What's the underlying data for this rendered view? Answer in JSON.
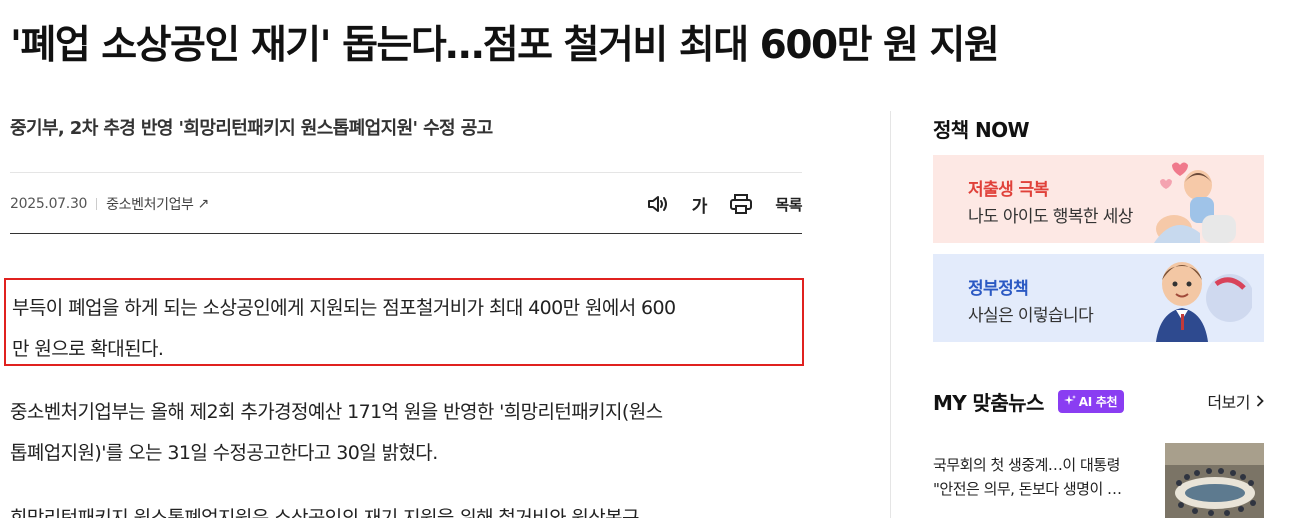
{
  "article": {
    "headline": "'폐업 소상공인 재기' 돕는다…점포 철거비 최대 600만 원 지원",
    "subtitle": "중기부, 2차 추경 반영 '희망리턴패키지 원스톱폐업지원' 수정 공고",
    "date": "2025.07.30",
    "source": "중소벤처기업부",
    "source_arrow": "↗",
    "tools": {
      "listen_icon": "speaker-icon",
      "font_label": "가",
      "print_icon": "printer-icon",
      "list_label": "목록"
    },
    "lead_lines": [
      "부득이 폐업을 하게 되는 소상공인에게 지원되는 점포철거비가 최대 400만 원에서 600",
      "만 원으로 확대된다."
    ],
    "body_p1_lines": [
      "중소벤처기업부는 올해 제2회 추가경정예산 171억 원을 반영한 '희망리턴패키지(원스",
      "톱폐업지원)'를 오는 31일 수정공고한다고 30일 밝혔다."
    ],
    "body_p2_partial": "희망리턴패키지 원스톱폐업지원은 소상공인의 재기 지원을 위해 철거비와 원상복구"
  },
  "sidebar": {
    "now_title": "정책 NOW",
    "banners": [
      {
        "title": "저출생 극복",
        "subtitle": "나도 아이도 행복한 세상"
      },
      {
        "title": "정부정책",
        "subtitle": "사실은 이렇습니다"
      }
    ],
    "my_news": {
      "title": "MY 맞춤뉴스",
      "ai_badge": "AI 추천",
      "more_label": "더보기",
      "more_icon": "chevron-right-icon",
      "item": {
        "line1": "국무회의 첫 생중계…이 대통령",
        "line2": "\"안전은 의무, 돈보다 생명이 …"
      }
    }
  },
  "colors": {
    "highlight_border": "#e0211f",
    "banner1_bg": "#fde8e4",
    "banner1_title": "#e0413a",
    "banner2_bg": "#e3ebfb",
    "banner2_title": "#2b59c3",
    "ai_badge": "#8a3df2"
  }
}
